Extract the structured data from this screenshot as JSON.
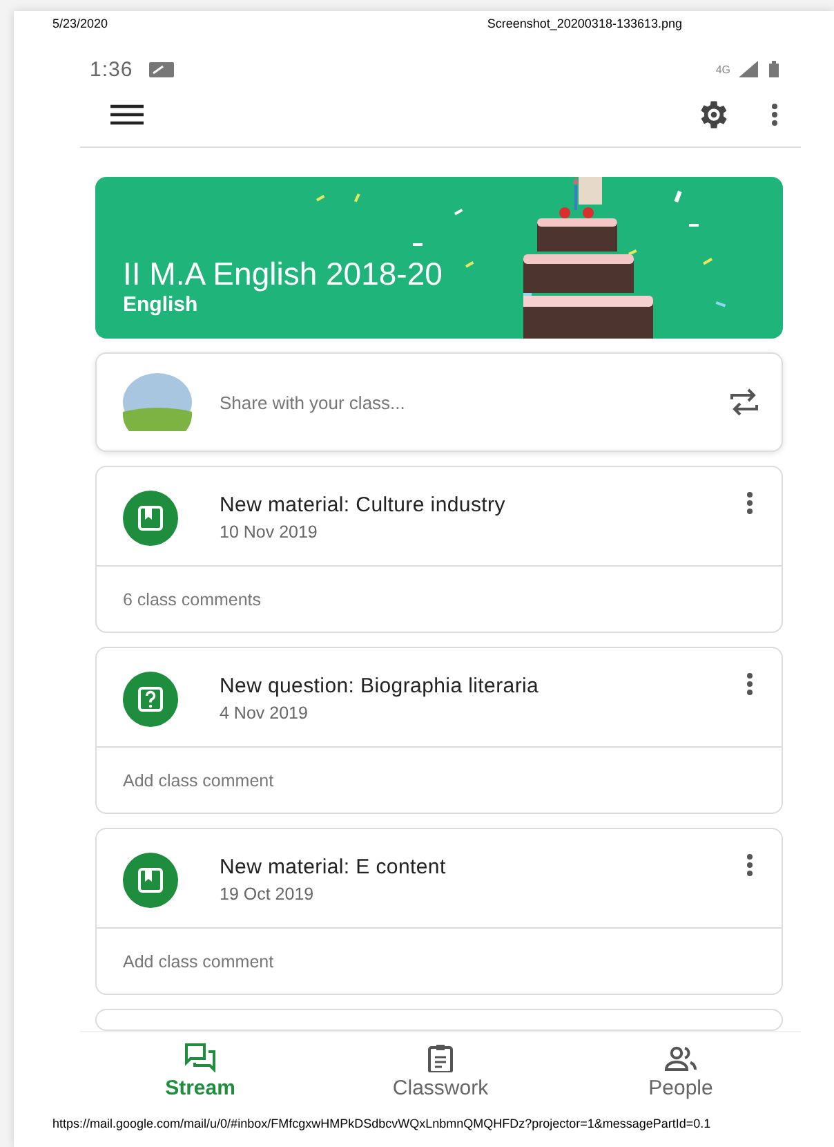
{
  "print_header": {
    "date": "5/23/2020",
    "filename": "Screenshot_20200318-133613.png"
  },
  "status_bar": {
    "time": "1:36",
    "network": "4G"
  },
  "class_banner": {
    "title": "II M.A English 2018-20",
    "section": "English"
  },
  "share": {
    "placeholder": "Share with your class..."
  },
  "posts": [
    {
      "kind": "material",
      "title": "New material: Culture industry",
      "date": "10 Nov 2019",
      "footer": "6 class comments"
    },
    {
      "kind": "question",
      "title": "New question: Biographia literaria",
      "date": "4 Nov 2019",
      "footer": "Add class comment"
    },
    {
      "kind": "material",
      "title": "New material: E content",
      "date": "19 Oct 2019",
      "footer": "Add class comment"
    }
  ],
  "bottom_nav": [
    {
      "kind": "stream",
      "label": "Stream",
      "selected": true
    },
    {
      "kind": "classwork",
      "label": "Classwork",
      "selected": false
    },
    {
      "kind": "people",
      "label": "People",
      "selected": false
    }
  ],
  "print_footer": {
    "url": "https://mail.google.com/mail/u/0/#inbox/FMfcgxwHMPkDSdbcvWQxLnbmnQMQHFDz?projector=1&messagePartId=0.1"
  }
}
